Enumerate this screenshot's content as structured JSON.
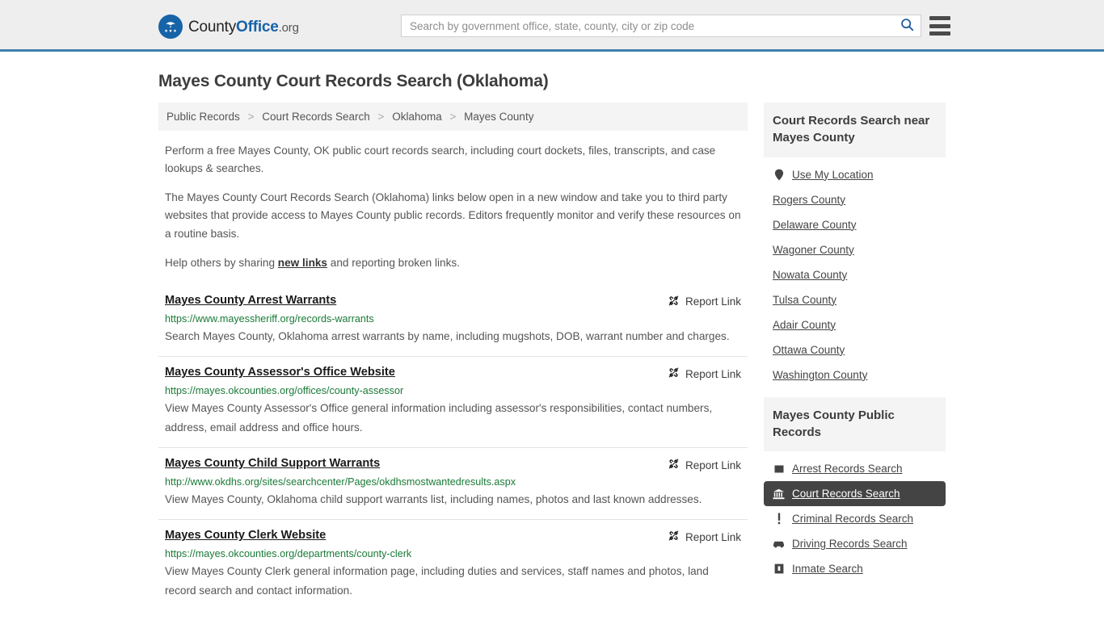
{
  "header": {
    "brand": {
      "part1": "County",
      "part2": "Office",
      "part3": ".org",
      "logo_icon": "eagle-shield-logo"
    },
    "search": {
      "placeholder": "Search by government office, state, county, city or zip code",
      "value": "",
      "icon": "search-icon"
    },
    "menu_icon": "hamburger-menu-icon",
    "accent_color": "#3f7fad"
  },
  "page": {
    "title": "Mayes County Court Records Search (Oklahoma)"
  },
  "breadcrumb": {
    "items": [
      {
        "label": "Public Records"
      },
      {
        "label": "Court Records Search"
      },
      {
        "label": "Oklahoma"
      },
      {
        "label": "Mayes County"
      }
    ],
    "separator": ">"
  },
  "intro": {
    "p1": "Perform a free Mayes County, OK public court records search, including court dockets, files, transcripts, and case lookups & searches.",
    "p2": "The Mayes County Court Records Search (Oklahoma) links below open in a new window and take you to third party websites that provide access to Mayes County public records. Editors frequently monitor and verify these resources on a routine basis.",
    "p3_before": "Help others by sharing ",
    "p3_link": "new links",
    "p3_after": " and reporting broken links."
  },
  "results": {
    "report_label": "Report Link",
    "report_icon": "broken-link-icon",
    "items": [
      {
        "title": "Mayes County Arrest Warrants",
        "url": "https://www.mayessheriff.org/records-warrants",
        "description": "Search Mayes County, Oklahoma arrest warrants by name, including mugshots, DOB, warrant number and charges."
      },
      {
        "title": "Mayes County Assessor's Office Website",
        "url": "https://mayes.okcounties.org/offices/county-assessor",
        "description": "View Mayes County Assessor's Office general information including assessor's responsibilities, contact numbers, address, email address and office hours."
      },
      {
        "title": "Mayes County Child Support Warrants",
        "url": "http://www.okdhs.org/sites/searchcenter/Pages/okdhsmostwantedresults.aspx",
        "description": "View Mayes County, Oklahoma child support warrants list, including names, photos and last known addresses."
      },
      {
        "title": "Mayes County Clerk Website",
        "url": "https://mayes.okcounties.org/departments/county-clerk",
        "description": "View Mayes County Clerk general information page, including duties and services, staff names and photos, land record search and contact information."
      }
    ]
  },
  "sidebar": {
    "nearby": {
      "heading": "Court Records Search near Mayes County",
      "items": [
        {
          "label": "Use My Location",
          "icon": "map-pin-icon"
        },
        {
          "label": "Rogers County",
          "icon": ""
        },
        {
          "label": "Delaware County",
          "icon": ""
        },
        {
          "label": "Wagoner County",
          "icon": ""
        },
        {
          "label": "Nowata County",
          "icon": ""
        },
        {
          "label": "Tulsa County",
          "icon": ""
        },
        {
          "label": "Adair County",
          "icon": ""
        },
        {
          "label": "Ottawa County",
          "icon": ""
        },
        {
          "label": "Washington County",
          "icon": ""
        }
      ]
    },
    "public_records": {
      "heading": "Mayes County Public Records",
      "items": [
        {
          "label": "Arrest Records Search",
          "icon": "square-icon",
          "active": false
        },
        {
          "label": "Court Records Search",
          "icon": "bank-icon",
          "active": true
        },
        {
          "label": "Criminal Records Search",
          "icon": "exclamation-icon",
          "active": false
        },
        {
          "label": "Driving Records Search",
          "icon": "car-icon",
          "active": false
        },
        {
          "label": "Inmate Search",
          "icon": "inmate-icon",
          "active": false
        }
      ]
    }
  }
}
